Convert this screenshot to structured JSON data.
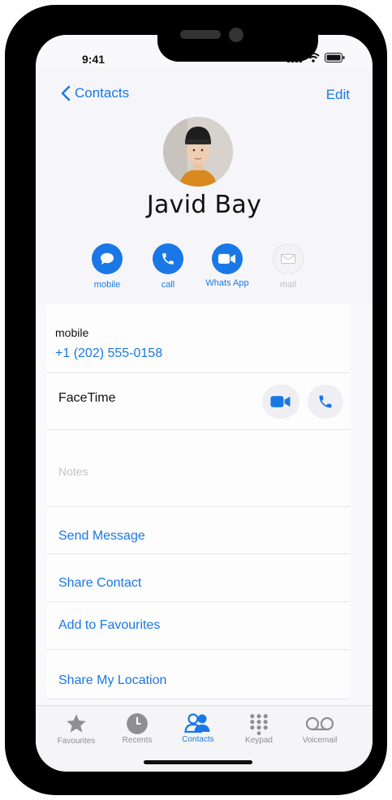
{
  "status": {
    "time": "9:41"
  },
  "nav": {
    "back_label": "Contacts",
    "edit_label": "Edit"
  },
  "contact": {
    "name": "Javid Bay"
  },
  "actions": [
    {
      "label": "mobile",
      "icon": "message-icon",
      "enabled": true
    },
    {
      "label": "call",
      "icon": "phone-icon",
      "enabled": true
    },
    {
      "label": "Whats App",
      "icon": "video-icon",
      "enabled": true
    },
    {
      "label": "mail",
      "icon": "mail-icon",
      "enabled": false
    }
  ],
  "phone_entry": {
    "label": "mobile",
    "number": "+1 (202) 555-0158"
  },
  "facetime": {
    "label": "FaceTime"
  },
  "notes": {
    "placeholder": "Notes"
  },
  "links": [
    "Send Message",
    "Share Contact",
    "Add to Favourites",
    "Share My Location"
  ],
  "tabs": [
    {
      "label": "Favourites",
      "icon": "star-icon",
      "active": false
    },
    {
      "label": "Recents",
      "icon": "clock-icon",
      "active": false
    },
    {
      "label": "Contacts",
      "icon": "contacts-icon",
      "active": true
    },
    {
      "label": "Keypad",
      "icon": "keypad-icon",
      "active": false
    },
    {
      "label": "Voicemail",
      "icon": "voicemail-icon",
      "active": false
    }
  ],
  "colors": {
    "accent": "#1a78e6",
    "inactive": "#8e8e93",
    "frame": "#000000"
  }
}
